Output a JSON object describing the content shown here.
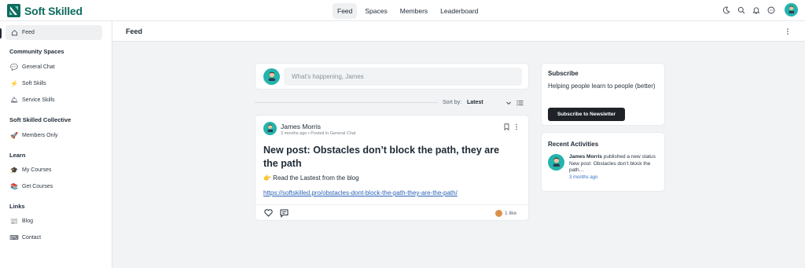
{
  "app": {
    "name": "Soft Skilled",
    "brand_color": "#0f6c5e"
  },
  "topnav": {
    "items": [
      {
        "label": "Feed",
        "active": true
      },
      {
        "label": "Spaces",
        "active": false
      },
      {
        "label": "Members",
        "active": false
      },
      {
        "label": "Leaderboard",
        "active": false
      }
    ],
    "icons": [
      "moon-icon",
      "search-icon",
      "bell-icon",
      "chat-icon"
    ]
  },
  "sidebar": {
    "feed": {
      "label": "Feed",
      "icon": "home-icon"
    },
    "sections": [
      {
        "title": "Community Spaces",
        "items": [
          {
            "label": "General Chat",
            "icon": "speech-bubble-icon"
          },
          {
            "label": "Soft Skills",
            "icon": "lightning-icon"
          },
          {
            "label": "Service Skills",
            "icon": "bell-service-icon"
          }
        ]
      },
      {
        "title": "Soft Skilled Collective",
        "items": [
          {
            "label": "Members Only",
            "icon": "rocket-icon"
          }
        ]
      },
      {
        "title": "Learn",
        "items": [
          {
            "label": "My Courses",
            "icon": "graduation-cap-icon"
          },
          {
            "label": "Get Courses",
            "icon": "books-icon"
          }
        ]
      },
      {
        "title": "Links",
        "items": [
          {
            "label": "Blog",
            "icon": "newspaper-icon"
          },
          {
            "label": "Contact",
            "icon": "keyboard-icon"
          }
        ]
      }
    ]
  },
  "main": {
    "title": "Feed"
  },
  "composer": {
    "placeholder": "What's happening, James"
  },
  "sort": {
    "label": "Sort by:",
    "value": "Latest"
  },
  "post": {
    "author": "James Morris",
    "meta": "3 months ago • Posted in General Chat",
    "title": "New post: Obstacles don’t block the path, they are the path",
    "body": "👉 Read the Lastest from the blog",
    "link": "https://softskilled.pro/obstacles-dont-block-the-path-they-are-the-path/",
    "likes": "1 like"
  },
  "subscribe": {
    "title": "Subscribe",
    "description": "Helping people learn to people (better)",
    "button": "Subscribe to Newsletter"
  },
  "recent": {
    "title": "Recent Activities",
    "author": "James Morris",
    "text": " published a new status New post: Obstacles don’t block the path…",
    "time": "3 months ago"
  }
}
